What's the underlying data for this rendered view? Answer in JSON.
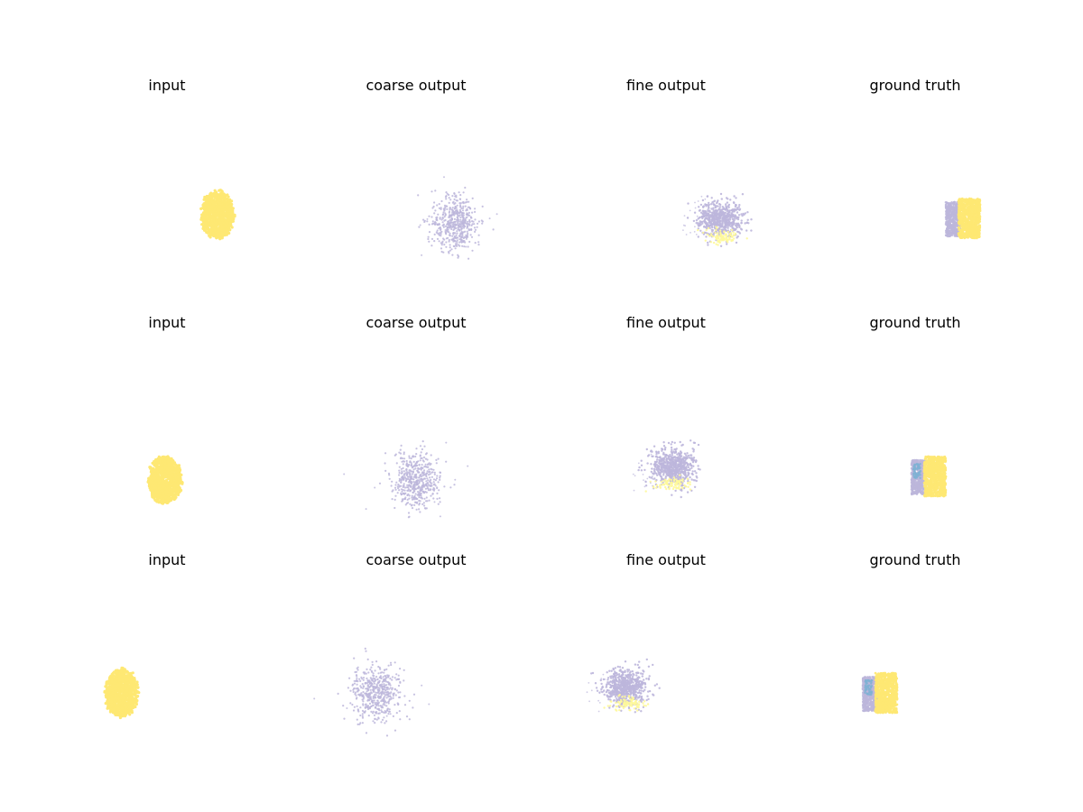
{
  "figure": {
    "type": "scatter",
    "chart_data": [
      {
        "type": "scatter",
        "title": "input",
        "row": 0,
        "col": 0,
        "shape": "blob",
        "color": "#fee873"
      },
      {
        "type": "scatter",
        "title": "coarse output",
        "row": 0,
        "col": 1,
        "shape": "cloud",
        "color": "#bcb6db"
      },
      {
        "type": "scatter",
        "title": "fine output",
        "row": 0,
        "col": 2,
        "shape": "fine",
        "color": "#bcb6db",
        "accent": "#fef89a"
      },
      {
        "type": "scatter",
        "title": "ground truth",
        "row": 0,
        "col": 3,
        "shape": "gt",
        "color": "#fee873",
        "accent": "#bcb6db"
      },
      {
        "type": "scatter",
        "title": "input",
        "row": 1,
        "col": 0,
        "shape": "blob",
        "color": "#fee873"
      },
      {
        "type": "scatter",
        "title": "coarse output",
        "row": 1,
        "col": 1,
        "shape": "cloud",
        "color": "#bcb6db"
      },
      {
        "type": "scatter",
        "title": "fine output",
        "row": 1,
        "col": 2,
        "shape": "fine",
        "color": "#bcb6db",
        "accent": "#fef89a"
      },
      {
        "type": "scatter",
        "title": "ground truth",
        "row": 1,
        "col": 3,
        "shape": "gt",
        "color": "#fee873",
        "accent": "#bcb6db",
        "accent2": "#7fb1d3"
      },
      {
        "type": "scatter",
        "title": "input",
        "row": 2,
        "col": 0,
        "shape": "blob",
        "color": "#fee873"
      },
      {
        "type": "scatter",
        "title": "coarse output",
        "row": 2,
        "col": 1,
        "shape": "cloud",
        "color": "#bcb6db"
      },
      {
        "type": "scatter",
        "title": "fine output",
        "row": 2,
        "col": 2,
        "shape": "fine",
        "color": "#bcb6db",
        "accent": "#fef89a"
      },
      {
        "type": "scatter",
        "title": "ground truth",
        "row": 2,
        "col": 3,
        "shape": "gt",
        "color": "#fee873",
        "accent": "#bcb6db",
        "accent2": "#7fb1d3"
      }
    ]
  }
}
